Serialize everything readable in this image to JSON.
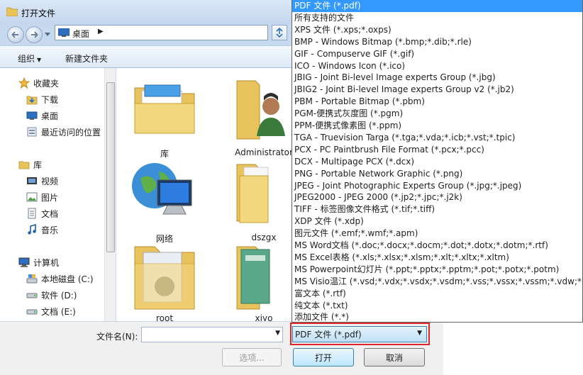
{
  "window": {
    "title": "打开文件"
  },
  "nav": {
    "location": "桌面"
  },
  "toolbar": {
    "organize_label": "组织",
    "new_folder_label": "新建文件夹"
  },
  "sidebar": {
    "favorites": {
      "label": "收藏夹",
      "items": [
        {
          "label": "下载"
        },
        {
          "label": "桌面"
        },
        {
          "label": "最近访问的位置"
        }
      ]
    },
    "libraries": {
      "label": "库",
      "items": [
        {
          "label": "视频"
        },
        {
          "label": "图片"
        },
        {
          "label": "文档"
        },
        {
          "label": "音乐"
        }
      ]
    },
    "computer": {
      "label": "计算机",
      "items": [
        {
          "label": "本地磁盘 (C:)"
        },
        {
          "label": "软件 (D:)"
        },
        {
          "label": "文档 (E:)"
        }
      ]
    }
  },
  "files": [
    {
      "name": "库",
      "icon": "library-folder-icon"
    },
    {
      "name": "Administrator",
      "icon": "user-folder-icon"
    },
    {
      "name": "网络",
      "icon": "network-icon"
    },
    {
      "name": "dszgx",
      "icon": "folder-icon"
    },
    {
      "name": "root",
      "icon": "folder-icon"
    },
    {
      "name": "xiyo",
      "icon": "folder-icon"
    }
  ],
  "bottom": {
    "filename_label": "文件名(N):",
    "filename_value": "",
    "filter_selected": "PDF 文件 (*.pdf)",
    "options_label": "选项...",
    "open_label": "打开",
    "cancel_label": "取消"
  },
  "dropdown_options": [
    "PDF 文件 (*.pdf)",
    "所有支持的文件",
    "XPS 文件 (*.xps;*.oxps)",
    "BMP - Windows Bitmap (*.bmp;*.dib;*.rle)",
    "GIF - Compuserve GIF (*.gif)",
    "ICO - Windows Icon (*.ico)",
    "JBIG - Joint Bi-level Image experts Group (*.jbg)",
    "JBIG2 - Joint Bi-level Image experts Group v2 (*.jb2)",
    "PBM - Portable Bitmap (*.pbm)",
    "PGM-便携式灰度图 (*.pgm)",
    "PPM-便携式像素图 (*.ppm)",
    "TGA - Truevision Targa (*.tga;*.vda;*.icb;*.vst;*.tpic)",
    "PCX - PC Paintbrush File Format (*.pcx;*.pcc)",
    "DCX - Multipage PCX (*.dcx)",
    "PNG - Portable Network Graphic (*.png)",
    "JPEG - Joint Photographic Experts Group (*.jpg;*.jpeg)",
    "JPEG2000 - JPEG 2000 (*.jp2;*.jpc;*.j2k)",
    "TIFF - 标签图像文件格式 (*.tif;*.tiff)",
    "XDP 文件 (*.xdp)",
    "图元文件 (*.emf;*.wmf;*.apm)",
    "MS Word文档 (*.doc;*.docx;*.docm;*.dot;*.dotx;*.dotm;*.rtf)",
    "MS Excel表格 (*.xls;*.xlsx;*.xlsm;*.xlt;*.xltx;*.xltm)",
    "MS Powerpoint幻灯片 (*.ppt;*.pptx;*.pptm;*.pot;*.potx;*.potm)",
    "MS Visio温江 (*.vsd;*.vdx;*.vsdx;*.vsdm;*.vss;*.vssx;*.vssm;*.vdw;*.vst;*.vs",
    "富文本 (*.rtf)",
    "纯文本 (*.txt)",
    "添加文件 (*.*)"
  ],
  "colors": {
    "selection": "#3399ff",
    "highlight_border": "#e0262d",
    "chrome": "#c7d9ee"
  }
}
